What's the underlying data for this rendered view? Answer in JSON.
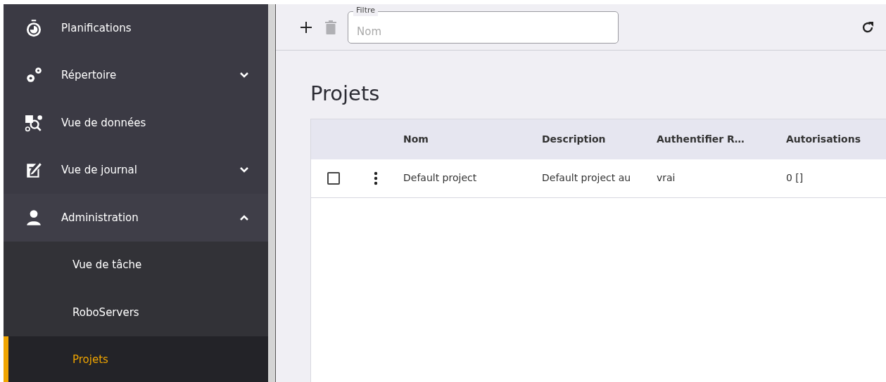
{
  "sidebar": {
    "items": [
      {
        "label": "Planifications"
      },
      {
        "label": "Répertoire",
        "expanded": false
      },
      {
        "label": "Vue de données"
      },
      {
        "label": "Vue de journal",
        "expanded": false
      },
      {
        "label": "Administration",
        "expanded": true,
        "children": [
          {
            "label": "Vue de tâche",
            "selected": false
          },
          {
            "label": "RoboServers",
            "selected": false
          },
          {
            "label": "Projets",
            "selected": true
          }
        ]
      }
    ]
  },
  "toolbar": {
    "delete_disabled": true,
    "filter": {
      "label": "Filtre",
      "placeholder": "Nom"
    }
  },
  "page_title": "Projets",
  "table": {
    "columns": [
      "Nom",
      "Description",
      "Authentifier R…",
      "Autorisations"
    ],
    "rows": [
      {
        "checked": false,
        "cells": [
          "Default project",
          "Default project au",
          "vrai",
          "0 []"
        ]
      }
    ]
  }
}
